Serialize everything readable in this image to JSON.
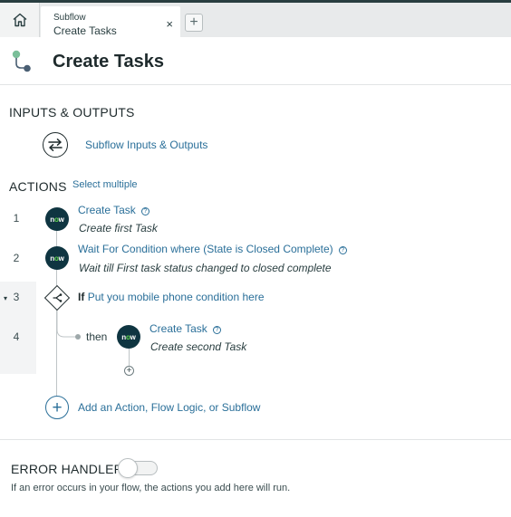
{
  "colors": {
    "accent_link": "#2a6f99",
    "text_dark": "#1e2a2c",
    "now_badge_bg": "#0f3541",
    "now_badge_dot": "#62d84e",
    "flow_icon_green": "#7bbf9a",
    "flow_icon_navy": "#4a5f73"
  },
  "tabs": [
    {
      "subtitle": "Subflow",
      "title": "Create Tasks",
      "close_icon": "×"
    }
  ],
  "add_tab_label": "+",
  "header": {
    "title": "Create Tasks",
    "icon": "subflow-icon"
  },
  "inputs_outputs": {
    "heading": "INPUTS & OUTPUTS",
    "link_label": "Subflow Inputs & Outputs",
    "icon": "swap-arrows-icon"
  },
  "actions": {
    "heading": "ACTIONS",
    "select_multiple_label": "Select multiple",
    "rows": [
      {
        "number": "1",
        "title": "Create Task",
        "description": "Create first Task",
        "badge_prefix": "n",
        "badge_o": "o",
        "badge_suffix": "w"
      },
      {
        "number": "2",
        "title": "Wait For Condition where (State is Closed Complete)",
        "description": "Wait till First task status changed to closed complete",
        "badge_prefix": "n",
        "badge_o": "o",
        "badge_suffix": "w"
      },
      {
        "number": "3",
        "if_keyword": "If",
        "condition": "Put you mobile phone condition here",
        "caret": "▾"
      },
      {
        "number": "4",
        "then_label": "then",
        "title": "Create Task",
        "description": "Create second Task",
        "badge_prefix": "n",
        "badge_o": "o",
        "badge_suffix": "w"
      }
    ],
    "nested_add_label": "+",
    "add_label": "+",
    "add_link_label": "Add an Action, Flow Logic, or Subflow"
  },
  "help_glyph": "?",
  "error_handler": {
    "heading": "ERROR HANDLER",
    "enabled": false,
    "description": "If an error occurs in your flow, the actions you add here will run."
  }
}
